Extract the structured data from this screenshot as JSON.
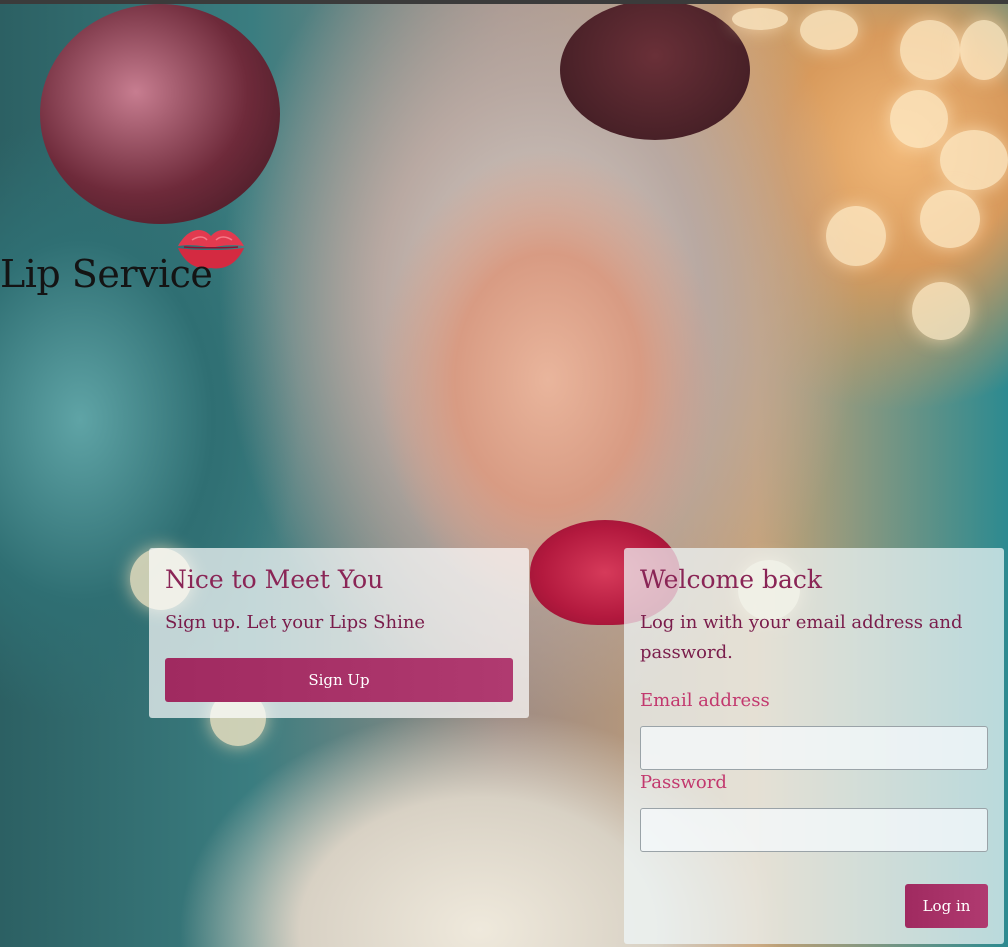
{
  "brand": {
    "name": "Lip Service",
    "logo_icon": "kiss-lips-icon",
    "lip_color": "#e23a4f"
  },
  "signup": {
    "title": "Nice to Meet You",
    "subtitle": "Sign up. Let your Lips Shine",
    "button_label": "Sign Up"
  },
  "login": {
    "title": "Welcome back",
    "subtitle": "Log in with your email address and password.",
    "email_label": "Email address",
    "email_value": "",
    "password_label": "Password",
    "password_value": "",
    "button_label": "Log in"
  },
  "colors": {
    "accent": "#a02a60",
    "heading": "#8a2556",
    "label": "#c2386e"
  }
}
